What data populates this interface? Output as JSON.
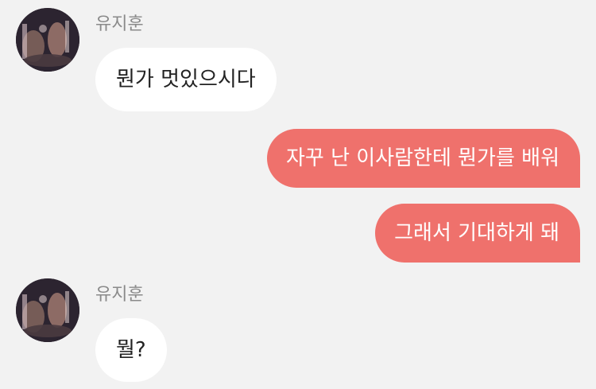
{
  "messages": [
    {
      "type": "incoming",
      "sender": "유지훈",
      "text": "뭔가 멋있으시다"
    },
    {
      "type": "outgoing",
      "text": "자꾸 난 이사람한테 뭔가를 배워"
    },
    {
      "type": "outgoing",
      "text": "그래서 기대하게 돼"
    },
    {
      "type": "incoming",
      "sender": "유지훈",
      "text": "뭘?"
    }
  ],
  "colors": {
    "background": "#f2f2f2",
    "incoming_bubble": "#ffffff",
    "outgoing_bubble": "#ef716c",
    "sender_name": "#8a8a8a"
  }
}
